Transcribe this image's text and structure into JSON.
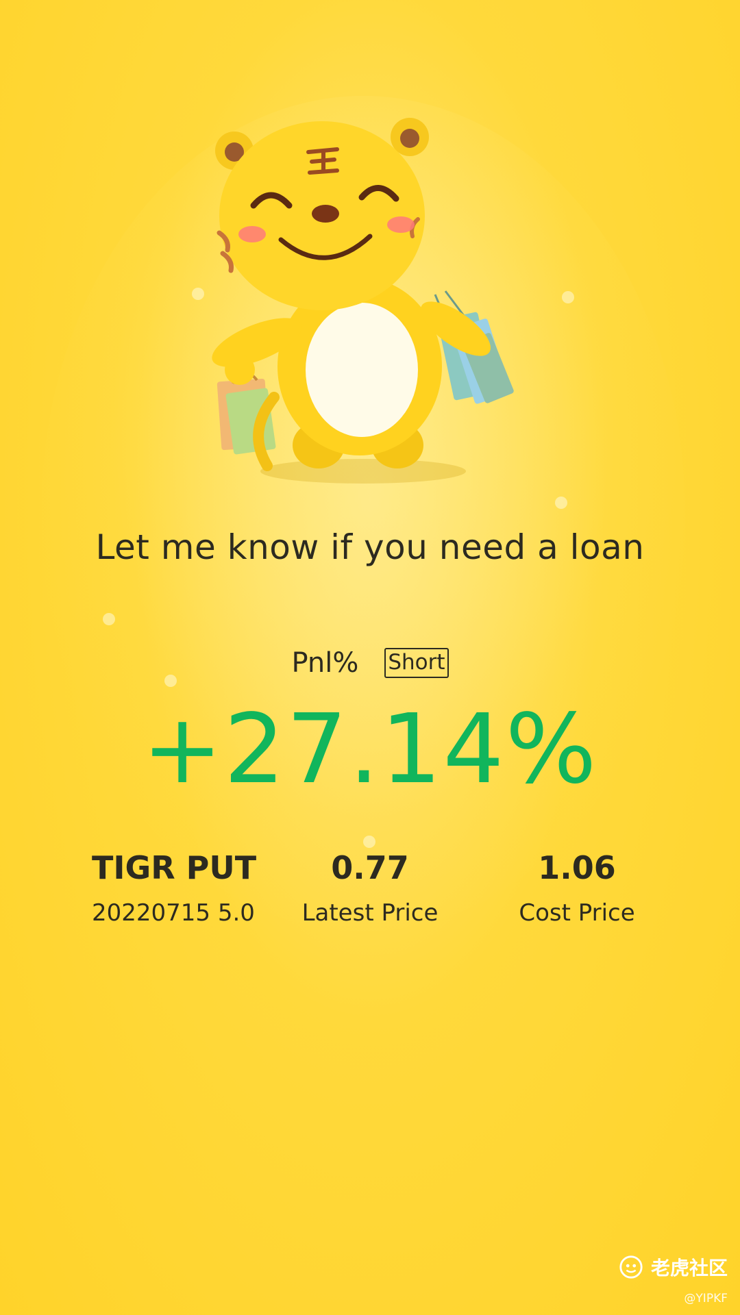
{
  "headline": "Let me know if you need a loan",
  "pnl": {
    "label": "Pnl%",
    "badge": "Short",
    "value": "+27.14%"
  },
  "contract": {
    "name": "TIGR PUT",
    "detail": "20220715 5.0"
  },
  "latest": {
    "value": "0.77",
    "label": "Latest Price"
  },
  "cost": {
    "value": "1.06",
    "label": "Cost Price"
  },
  "watermark": {
    "brand": "老虎社区",
    "handle": "@YIPKF"
  },
  "colors": {
    "background": "#ffd32a",
    "gain": "#11b55c",
    "text": "#2c2a20"
  },
  "icons": {
    "mascot": "tiger-mascot-illustration",
    "brand_logo": "tiger-community-logo-icon"
  }
}
